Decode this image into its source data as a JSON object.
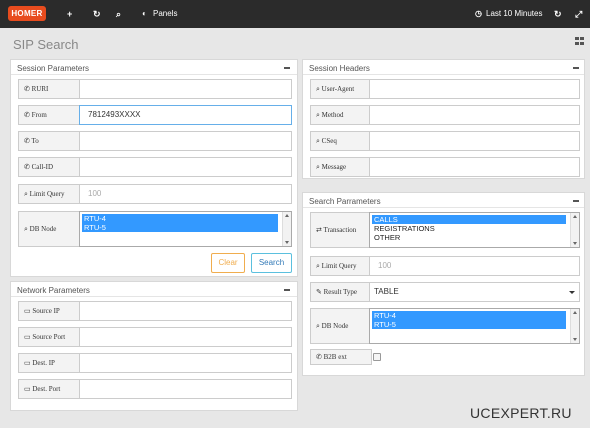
{
  "topbar": {
    "logo_text": "HOMER",
    "add_glyph": "+",
    "refresh_glyph": "↻",
    "search_glyph": "⌕",
    "panels_label": "Panels",
    "time_label": "Last 10 Minutes",
    "refresh2_glyph": "↻",
    "expand_glyph": "⤢"
  },
  "page": {
    "title": "SIP Search"
  },
  "session_params": {
    "title": "Session Parameters",
    "fields": [
      {
        "label": "RURI",
        "value": "",
        "placeholder": ""
      },
      {
        "label": "From",
        "value": "7812493XXXX",
        "placeholder": ""
      },
      {
        "label": "To",
        "value": "",
        "placeholder": ""
      },
      {
        "label": "Call-ID",
        "value": "",
        "placeholder": ""
      },
      {
        "label": "Limit Query",
        "value": "",
        "placeholder": "100"
      }
    ],
    "db_node": {
      "label": "DB Node",
      "options": [
        "RTU-4",
        "RTU-5"
      ]
    },
    "clear_label": "Clear",
    "search_label": "Search"
  },
  "network_params": {
    "title": "Network Parameters",
    "fields": [
      {
        "label": "Source IP",
        "value": ""
      },
      {
        "label": "Source Port",
        "value": ""
      },
      {
        "label": "Dest. IP",
        "value": ""
      },
      {
        "label": "Dest. Port",
        "value": ""
      }
    ]
  },
  "session_headers": {
    "title": "Session Headers",
    "fields": [
      {
        "label": "User-Agent",
        "value": ""
      },
      {
        "label": "Method",
        "value": ""
      },
      {
        "label": "CSeq",
        "value": ""
      },
      {
        "label": "Message",
        "value": ""
      }
    ]
  },
  "search_params": {
    "title": "Search Parrameters",
    "transaction": {
      "label": "Transaction",
      "options": [
        "CALLS",
        "REGISTRATIONS",
        "OTHER"
      ]
    },
    "limit_query": {
      "label": "Limit Query",
      "placeholder": "100"
    },
    "result_type": {
      "label": "Result Type",
      "value": "TABLE"
    },
    "db_node": {
      "label": "DB Node",
      "options": [
        "RTU-4",
        "RTU-5"
      ]
    },
    "b2b": {
      "label": "B2B ext"
    }
  },
  "watermark": "UCEXPERT.RU",
  "icons": {
    "label_icon_phone": "✆",
    "label_icon_search": "⌕",
    "label_icon_pencil": "✎",
    "label_icon_laptop": "▭",
    "label_icon_dbnode": "⌕",
    "label_icon_toggle": "⇄",
    "label_icon_b2b": "✆"
  },
  "colors": {
    "topbar": "#2b2b2b",
    "logo": "#e84c1e",
    "selected": "#3399ff",
    "clear_button": "#f0ad4e",
    "search_button": "#5bc0de"
  }
}
